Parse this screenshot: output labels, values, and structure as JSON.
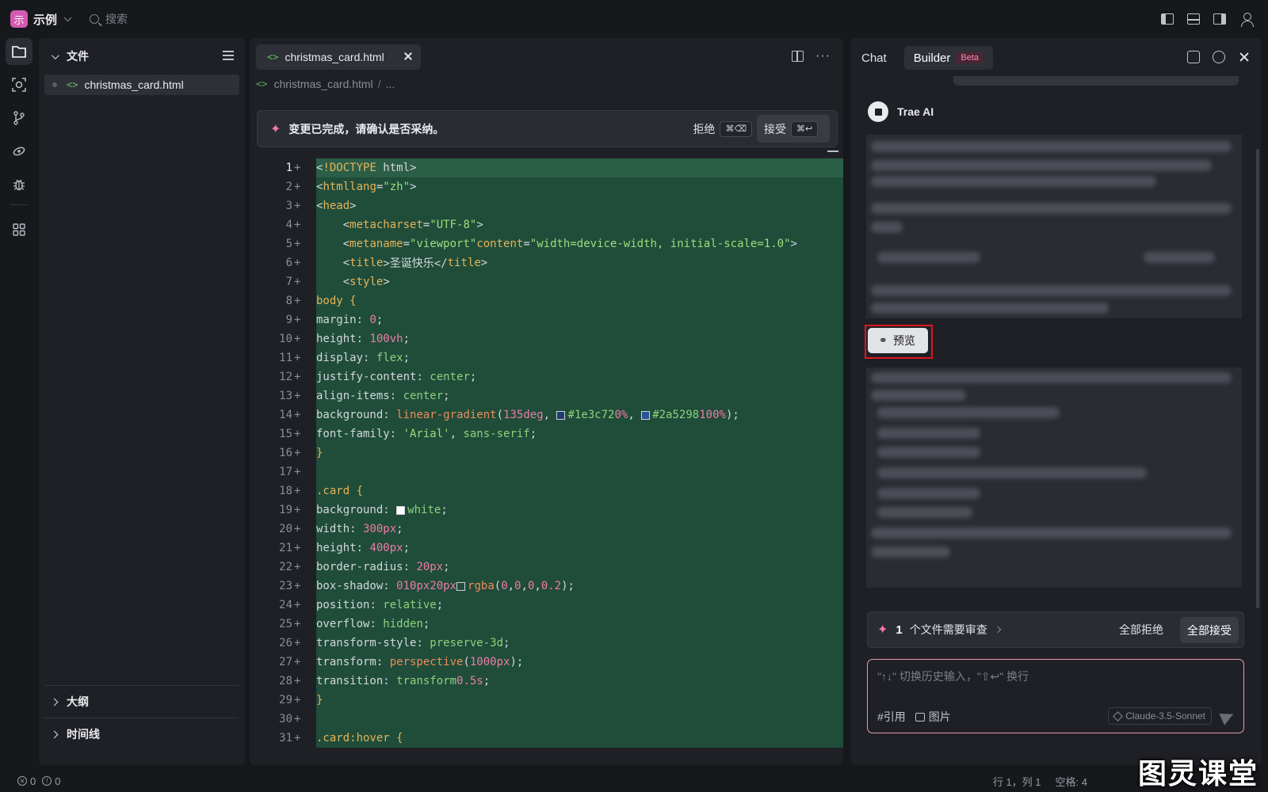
{
  "topbar": {
    "brand_logo": "示",
    "brand_name": "示例",
    "search_placeholder": "搜索"
  },
  "explorer": {
    "title": "文件",
    "files": [
      {
        "name": "christmas_card.html"
      }
    ],
    "sections": [
      {
        "label": "大纲"
      },
      {
        "label": "时间线"
      }
    ]
  },
  "editor": {
    "tab_label": "christmas_card.html",
    "breadcrumb_file": "christmas_card.html",
    "breadcrumb_more": "...",
    "banner": {
      "text": "变更已完成，请确认是否采纳。",
      "reject_label": "拒绝",
      "reject_kbd": "⌘⌫",
      "accept_label": "接受",
      "accept_kbd": "⌘↩"
    },
    "lines": [
      "<!DOCTYPE html>",
      "<html lang=\"zh\">",
      "<head>",
      "    <meta charset=\"UTF-8\">",
      "    <meta name=\"viewport\" content=\"width=device-width, initial-scale=1.0\">",
      "    <title>圣诞快乐</title>",
      "    <style>",
      "        body {",
      "            margin: 0;",
      "            height: 100vh;",
      "            display: flex;",
      "            justify-content: center;",
      "            align-items: center;",
      "            background: linear-gradient(135deg, #1e3c72 0%, #2a5298 100%);",
      "            font-family: 'Arial', sans-serif;",
      "        }",
      "",
      "        .card {",
      "            background: white;",
      "            width: 300px;",
      "            height: 400px;",
      "            border-radius: 20px;",
      "            box-shadow: 0 10px 20px rgba(0,0,0,0.2);",
      "            position: relative;",
      "            overflow: hidden;",
      "            transform-style: preserve-3d;",
      "            transform: perspective(1000px);",
      "            transition: transform 0.5s;",
      "        }",
      "",
      "        .card:hover {"
    ]
  },
  "chat": {
    "tab_chat": "Chat",
    "tab_builder": "Builder",
    "beta": "Beta",
    "ai_name": "Trae AI",
    "preview_label": "预览",
    "review": {
      "count": "1",
      "text": "个文件需要审查",
      "reject_all": "全部拒绝",
      "accept_all": "全部接受"
    },
    "input_placeholder": "\"↑↓\" 切换历史输入，\"⇧↩\" 换行",
    "tool_quote": "引用",
    "tool_image": "图片",
    "model": "Claude-3.5-Sonnet"
  },
  "status": {
    "errors": "0",
    "warnings": "0",
    "position": "行 1，列 1",
    "spaces": "空格: 4"
  },
  "watermark": "图灵课堂"
}
